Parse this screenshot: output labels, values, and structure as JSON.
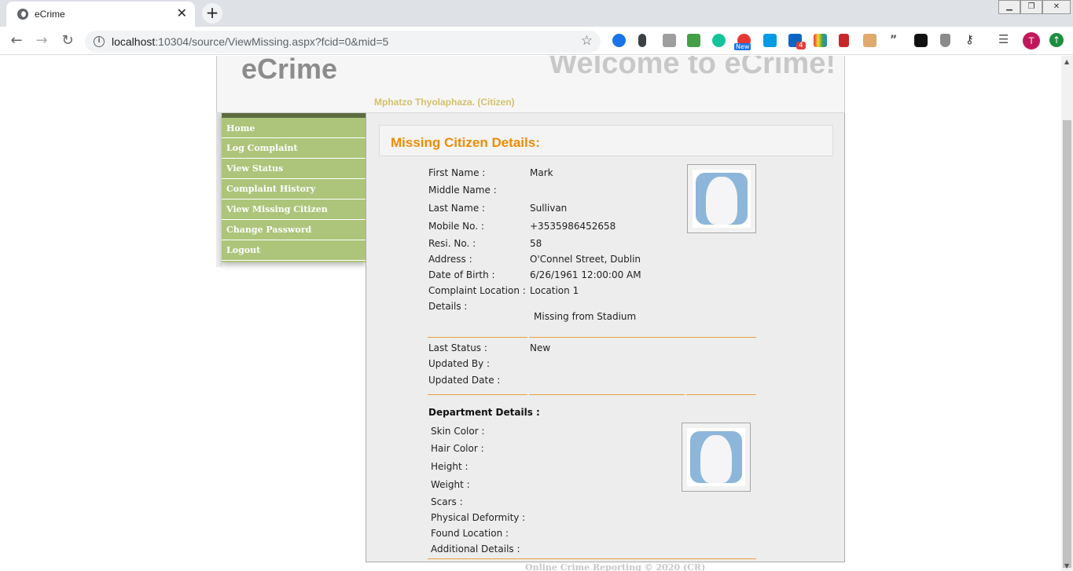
{
  "browser": {
    "tab_title": "eCrime",
    "url_host": "localhost",
    "url_rest": ":10304/source/ViewMissing.aspx?fcid=0&mid=5",
    "avatar_letter": "T",
    "extension_badge_new": "New",
    "extension_badge_count": "4"
  },
  "header": {
    "logo": "eCrime",
    "welcome": "Welcome to eCrime!",
    "user": "Mphatzo Thyolaphaza. (Citizen)"
  },
  "sidebar": {
    "items": [
      {
        "label": "Home"
      },
      {
        "label": "Log Complaint"
      },
      {
        "label": "View Status"
      },
      {
        "label": "Complaint History"
      },
      {
        "label": "View Missing Citizen"
      },
      {
        "label": "Change Password"
      },
      {
        "label": "Logout"
      }
    ]
  },
  "panel": {
    "title": "Missing Citizen Details:"
  },
  "citizen": {
    "first_name_label": "First Name :",
    "first_name": "Mark",
    "middle_name_label": "Middle Name :",
    "middle_name": "",
    "last_name_label": "Last Name :",
    "last_name": "Sullivan",
    "mobile_label": "Mobile No. :",
    "mobile": "+3535986452658",
    "resi_label": "Resi. No. :",
    "resi": "58",
    "address_label": "Address :",
    "address": "O'Connel Street, Dublin",
    "dob_label": "Date of Birth :",
    "dob": "6/26/1961 12:00:00 AM",
    "location_label": "Complaint Location :",
    "location": "Location 1",
    "details_label": "Details :",
    "details": "Missing from Stadium"
  },
  "status": {
    "last_status_label": "Last Status :",
    "last_status": "New",
    "updated_by_label": "Updated By :",
    "updated_by": "",
    "updated_date_label": "Updated Date :",
    "updated_date": ""
  },
  "department": {
    "heading": "Department Details :",
    "skin_label": "Skin Color :",
    "hair_label": "Hair Color :",
    "height_label": "Height :",
    "weight_label": "Weight :",
    "scars_label": "Scars :",
    "deformity_label": "Physical Deformity :",
    "found_label": "Found Location :",
    "additional_label": "Additional Details :"
  },
  "footer": "Online Crime Reporting © 2020 (CR)",
  "colors": {
    "accent": "#f08c00",
    "menu": "#acc57b",
    "rule": "#e8a23a"
  }
}
